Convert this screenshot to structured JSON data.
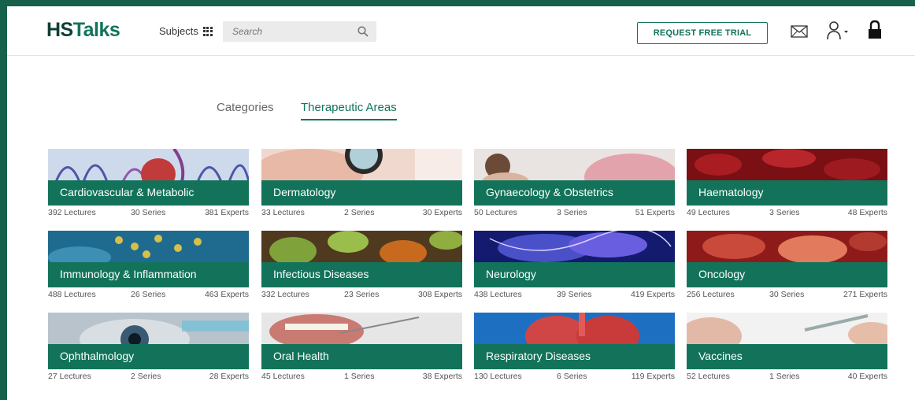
{
  "header": {
    "logo_hs": "HS",
    "logo_talks": "Talks",
    "subjects_label": "Subjects",
    "search_placeholder": "Search",
    "trial_button": "REQUEST FREE TRIAL",
    "icons": [
      "grid-icon",
      "search-icon",
      "mail-icon",
      "user-icon",
      "chevron-down-icon",
      "lock-icon"
    ]
  },
  "tabs": [
    {
      "label": "Categories",
      "active": false
    },
    {
      "label": "Therapeutic Areas",
      "active": true
    }
  ],
  "colors": {
    "brand_green": "#12735a",
    "frame_green": "#17604b",
    "logo_dark": "#0f3f35"
  },
  "cards": [
    {
      "title": "Cardiovascular & Metabolic",
      "lectures": "392 Lectures",
      "series": "30 Series",
      "experts": "381 Experts"
    },
    {
      "title": "Dermatology",
      "lectures": "33 Lectures",
      "series": "2 Series",
      "experts": "30 Experts"
    },
    {
      "title": "Gynaecology & Obstetrics",
      "lectures": "50 Lectures",
      "series": "3 Series",
      "experts": "51 Experts"
    },
    {
      "title": "Haematology",
      "lectures": "49 Lectures",
      "series": "3 Series",
      "experts": "48 Experts"
    },
    {
      "title": "Immunology & Inflammation",
      "lectures": "488 Lectures",
      "series": "26 Series",
      "experts": "463 Experts"
    },
    {
      "title": "Infectious Diseases",
      "lectures": "332 Lectures",
      "series": "23 Series",
      "experts": "308 Experts"
    },
    {
      "title": "Neurology",
      "lectures": "438 Lectures",
      "series": "39 Series",
      "experts": "419 Experts"
    },
    {
      "title": "Oncology",
      "lectures": "256 Lectures",
      "series": "30 Series",
      "experts": "271 Experts"
    },
    {
      "title": "Ophthalmology",
      "lectures": "27 Lectures",
      "series": "2 Series",
      "experts": "28 Experts"
    },
    {
      "title": "Oral Health",
      "lectures": "45 Lectures",
      "series": "1 Series",
      "experts": "38 Experts"
    },
    {
      "title": "Respiratory Diseases",
      "lectures": "130 Lectures",
      "series": "6 Series",
      "experts": "119 Experts"
    },
    {
      "title": "Vaccines",
      "lectures": "52 Lectures",
      "series": "1 Series",
      "experts": "40 Experts"
    }
  ]
}
